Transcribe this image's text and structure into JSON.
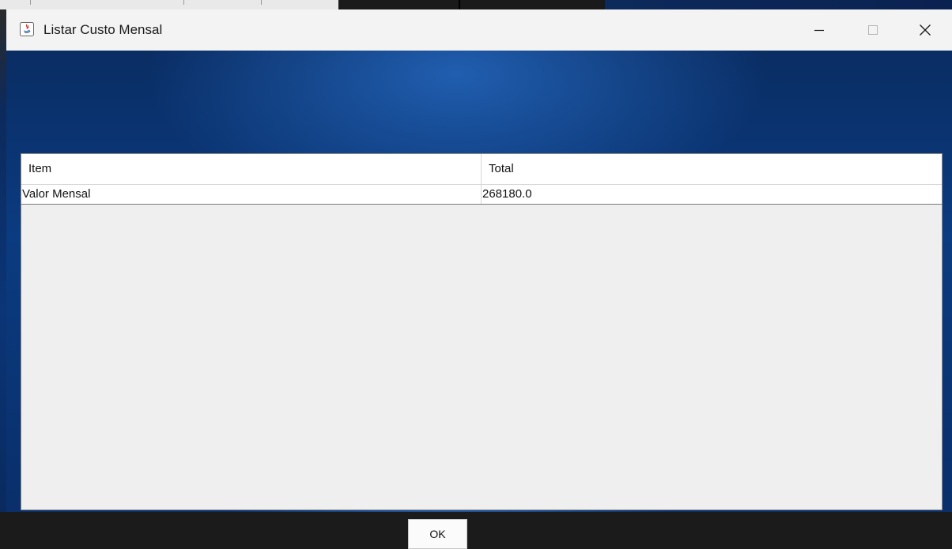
{
  "window": {
    "title": "Listar Custo Mensal",
    "app_icon": "java-app-icon",
    "controls": {
      "minimize": "minimize-icon",
      "maximize": "maximize-icon",
      "close": "close-icon"
    }
  },
  "table": {
    "columns": [
      "Item",
      "Total"
    ],
    "rows": [
      [
        "Valor Mensal",
        "268180.0"
      ]
    ]
  },
  "actions": {
    "ok_label": "OK"
  },
  "colors": {
    "background_blue": "#0b3b80",
    "panel": "#efefef"
  }
}
